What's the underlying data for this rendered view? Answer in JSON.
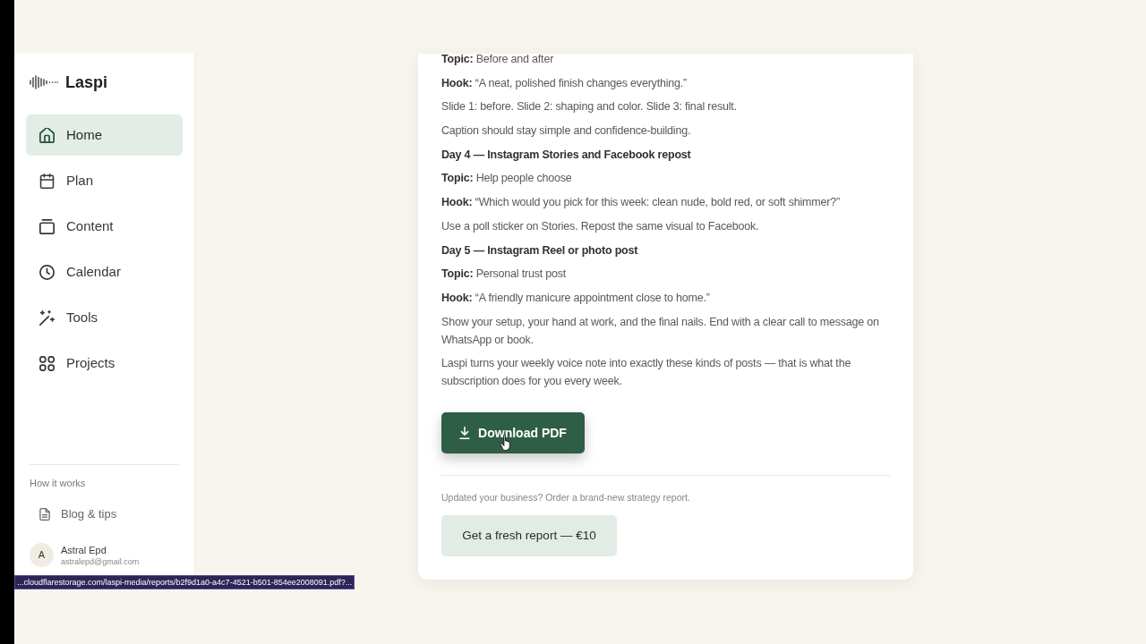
{
  "sidebar": {
    "brand": "Laspi",
    "nav": [
      {
        "label": "Home",
        "selected": true
      },
      {
        "label": "Plan",
        "selected": false
      },
      {
        "label": "Content",
        "selected": false
      },
      {
        "label": "Calendar",
        "selected": false
      },
      {
        "label": "Tools",
        "selected": false
      },
      {
        "label": "Projects",
        "selected": false
      }
    ],
    "section_label": "How it works",
    "links": [
      {
        "label": "Blog & tips"
      }
    ],
    "user": {
      "initial": "A",
      "name": "Astral Epd",
      "email": "astralepd@gmail.com"
    }
  },
  "report": {
    "blocks": [
      {
        "kind": "paragraph",
        "text": "**Topic:** Before and after"
      },
      {
        "kind": "paragraph",
        "text": "**Hook:** “A neat, polished finish changes everything.”"
      },
      {
        "kind": "paragraph",
        "text": "Slide 1: before. Slide 2: shaping and color. Slide 3: final result."
      },
      {
        "kind": "paragraph",
        "text": "Caption should stay simple and confidence-building."
      },
      {
        "kind": "heading",
        "text": "Day 4 — Instagram Stories and Facebook repost"
      },
      {
        "kind": "paragraph",
        "text": "**Topic:** Help people choose"
      },
      {
        "kind": "paragraph",
        "text": "**Hook:** “Which would you pick for this week: clean nude, bold red, or soft shimmer?”"
      },
      {
        "kind": "paragraph",
        "text": "Use a poll sticker on Stories. Repost the same visual to Facebook."
      },
      {
        "kind": "heading",
        "text": "Day 5 — Instagram Reel or photo post"
      },
      {
        "kind": "paragraph",
        "text": "**Topic:** Personal trust post"
      },
      {
        "kind": "paragraph",
        "text": "**Hook:** “A friendly manicure appointment close to home.”"
      },
      {
        "kind": "paragraph",
        "text": "Show your setup, your hand at work, and the final nails. End with a clear call to message on WhatsApp or book."
      },
      {
        "kind": "paragraph",
        "text": "Laspi turns your weekly voice note into exactly these kinds of posts — that is what the subscription does for you every week."
      }
    ],
    "download_button": "Download PDF",
    "reorder_note": "Updated your business? Order a brand-new strategy report.",
    "fresh_report_button": "Get a fresh report — €10"
  },
  "status_bar": {
    "url": "...cloudflarestorage.com/laspi-media/reports/b2f9d1a0-a4c7-4521-b501-854ee2008091.pdf?..."
  }
}
